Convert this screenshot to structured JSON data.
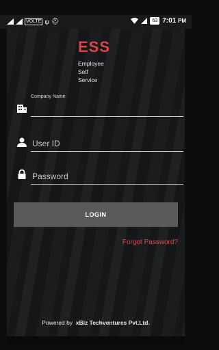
{
  "status_bar": {
    "volte_label": "VOLTE",
    "battery_percent": "63",
    "time": "7:01",
    "time_suffix": "PM"
  },
  "app": {
    "logo_title": "ESS",
    "logo_sub_line1": "Employee",
    "logo_sub_line2": "Self",
    "logo_sub_line3": "Service"
  },
  "form": {
    "company_label": "Company Name",
    "company_value": "",
    "userid_placeholder": "User ID",
    "password_placeholder": "Password",
    "login_label": "LOGIN",
    "forgot_label": "Forgot Password?"
  },
  "footer": {
    "powered_prefix": "Powered by",
    "company": "xBiz Techventures Pvt.Ltd."
  },
  "icons": {
    "company": "building-icon",
    "user": "person-icon",
    "password": "lock-icon"
  },
  "colors": {
    "brand": "#d9454a",
    "button": "#5a5a5a",
    "link": "#e0484e"
  }
}
